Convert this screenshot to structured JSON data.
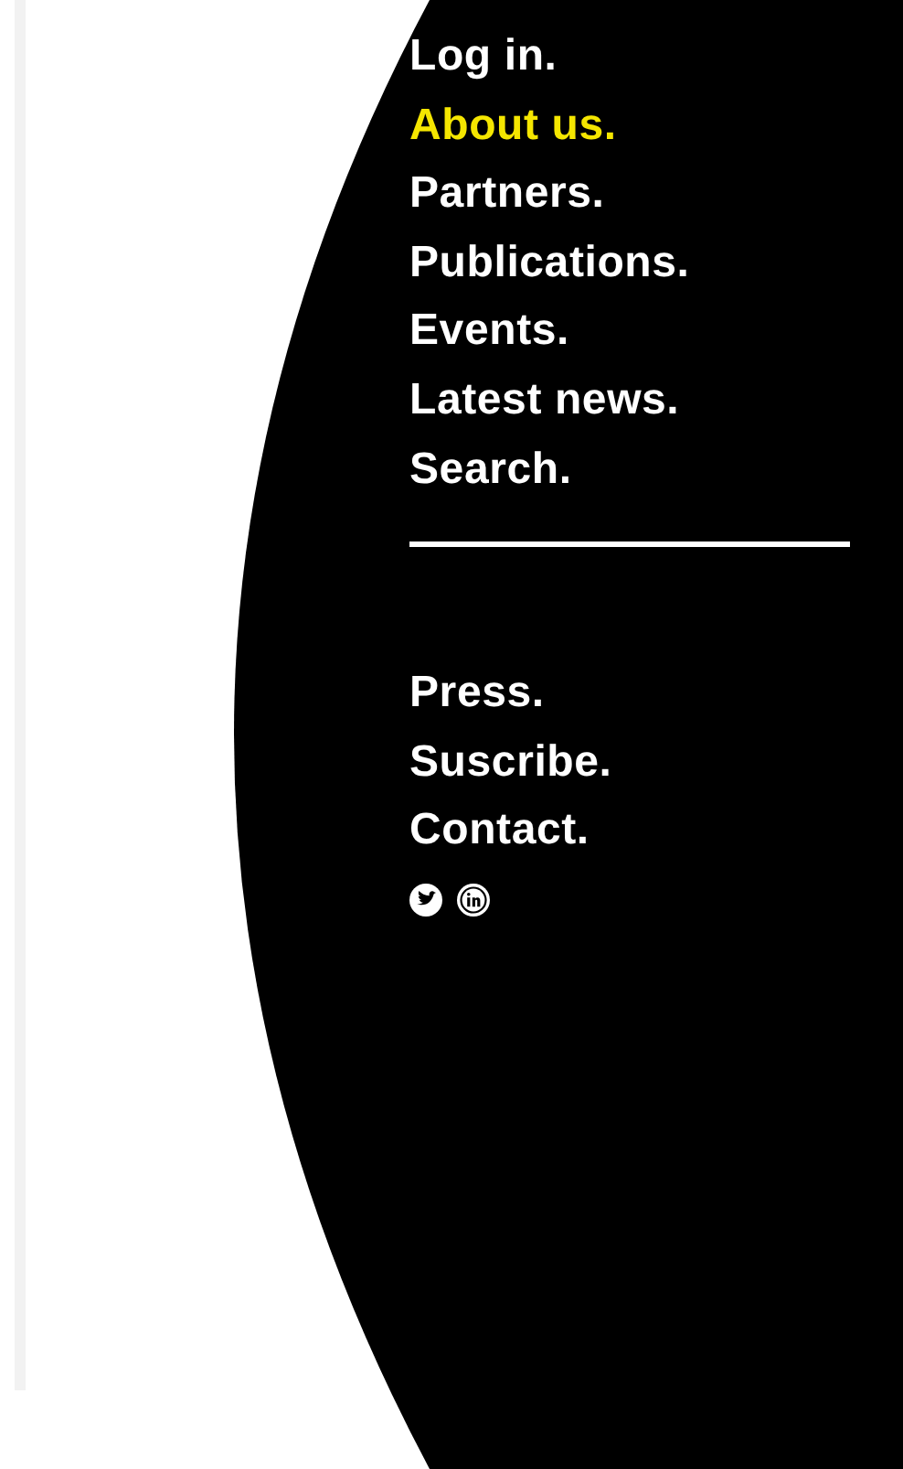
{
  "nav": {
    "primary": [
      {
        "label": "Log in.",
        "selected": false
      },
      {
        "label": "About us.",
        "selected": true
      },
      {
        "label": "Partners.",
        "selected": false
      },
      {
        "label": "Publications.",
        "selected": false
      },
      {
        "label": "Events.",
        "selected": false
      },
      {
        "label": "Latest news.",
        "selected": false
      },
      {
        "label": "Search.",
        "selected": false
      }
    ],
    "secondary": [
      {
        "label": "Press.",
        "selected": false
      },
      {
        "label": "Suscribe.",
        "selected": false
      },
      {
        "label": "Contact.",
        "selected": false
      }
    ]
  }
}
